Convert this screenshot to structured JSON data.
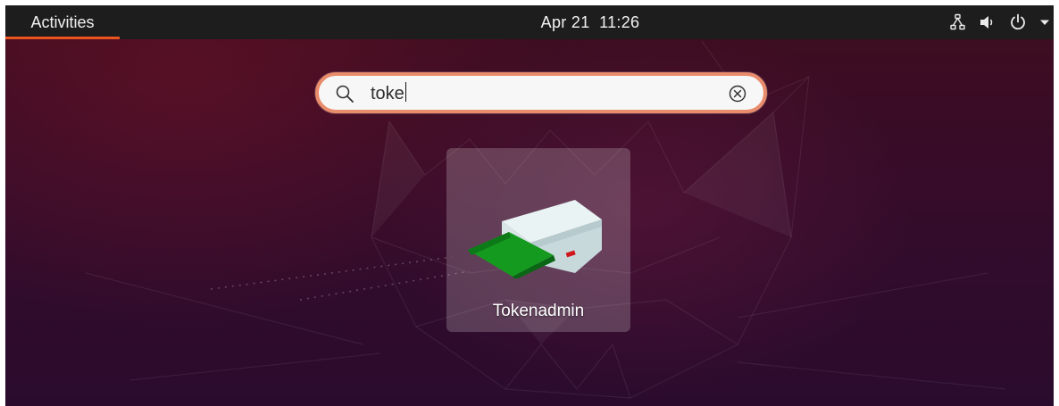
{
  "topbar": {
    "activities_label": "Activities",
    "clock": "Apr 21  11:26",
    "tray_icons": [
      "network-icon",
      "volume-icon",
      "power-icon",
      "chevron-down-icon"
    ],
    "accent_color": "#e95420"
  },
  "search": {
    "value": "toke",
    "icon": "search-icon",
    "clear_icon": "clear-icon",
    "border_color": "#e98c6b"
  },
  "results": {
    "apps": [
      {
        "label": "Tokenadmin",
        "icon": "smartcard-reader-icon"
      }
    ]
  }
}
